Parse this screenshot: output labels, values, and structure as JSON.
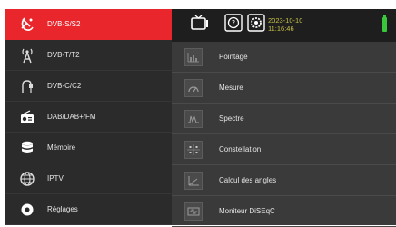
{
  "sidebar": {
    "items": [
      {
        "label": "DVB-S/S2",
        "icon": "satellite-dish-icon",
        "active": true
      },
      {
        "label": "DVB-T/T2",
        "icon": "antenna-icon",
        "active": false
      },
      {
        "label": "DVB-C/C2",
        "icon": "cable-icon",
        "active": false
      },
      {
        "label": "DAB/DAB+/FM",
        "icon": "radio-icon",
        "active": false
      },
      {
        "label": "Mémoire",
        "icon": "database-icon",
        "active": false
      },
      {
        "label": "IPTV",
        "icon": "globe-icon",
        "active": false
      },
      {
        "label": "Réglages",
        "icon": "settings-icon",
        "active": false
      }
    ]
  },
  "topbar": {
    "date": "2023-10-10",
    "time": "11:16:46",
    "battery_color": "#39c83a"
  },
  "menu": {
    "items": [
      {
        "label": "Pointage",
        "icon": "pointing-icon"
      },
      {
        "label": "Mesure",
        "icon": "measure-icon"
      },
      {
        "label": "Spectre",
        "icon": "spectrum-icon"
      },
      {
        "label": "Constellation",
        "icon": "constellation-icon"
      },
      {
        "label": "Calcul des angles",
        "icon": "angle-calc-icon"
      },
      {
        "label": "Moniteur DiSEqC",
        "icon": "diseqc-monitor-icon"
      }
    ]
  },
  "colors": {
    "accent": "#e8262b",
    "datetime": "#c9c24a"
  }
}
